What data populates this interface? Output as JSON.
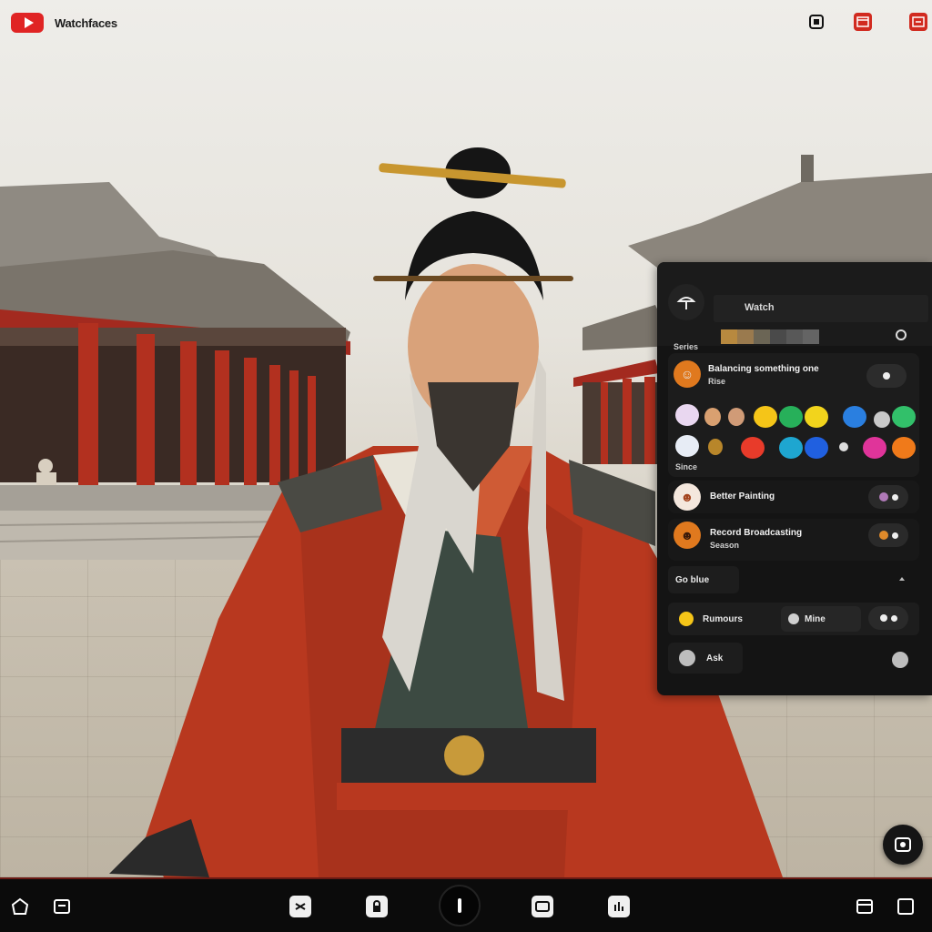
{
  "header": {
    "channel_name": "Watchfaces",
    "icons": [
      "youtube-logo-icon",
      "tv-icon",
      "window-icon",
      "cast-icon"
    ]
  },
  "panel": {
    "title": "Watch",
    "subtitle": "Series",
    "swatch_colors": [
      "#b8893f",
      "#9a7a4e",
      "#6b6555",
      "#4a4a4a",
      "#585858",
      "#646464"
    ],
    "comments": [
      {
        "name": "Balancing something one",
        "meta": "Rise"
      },
      {
        "name": "Better Painting",
        "meta": ""
      },
      {
        "name": "Record Broadcasting",
        "meta": "Season"
      }
    ],
    "reactions_label": "Since",
    "reaction_colors": [
      "#e9d7f0",
      "#d9a070",
      "#f5c518",
      "#27b05a",
      "#f2d41c",
      "#2a7fe0",
      "#c9c9c9",
      "#32c06a",
      "#e7ecf5",
      "#b8862a",
      "#e83b2a",
      "#1ea6d0",
      "#2060e0",
      "#dddddd",
      "#e0349a",
      "#f07a1a"
    ],
    "section_label": "Go blue",
    "footer_item_1": "Rumours",
    "footer_item_2": "Mine",
    "footer_item_3": "Ask"
  },
  "colors": {
    "brand_red": "#e02424",
    "panel_bg": "#141414",
    "robe_red": "#b8381f"
  }
}
